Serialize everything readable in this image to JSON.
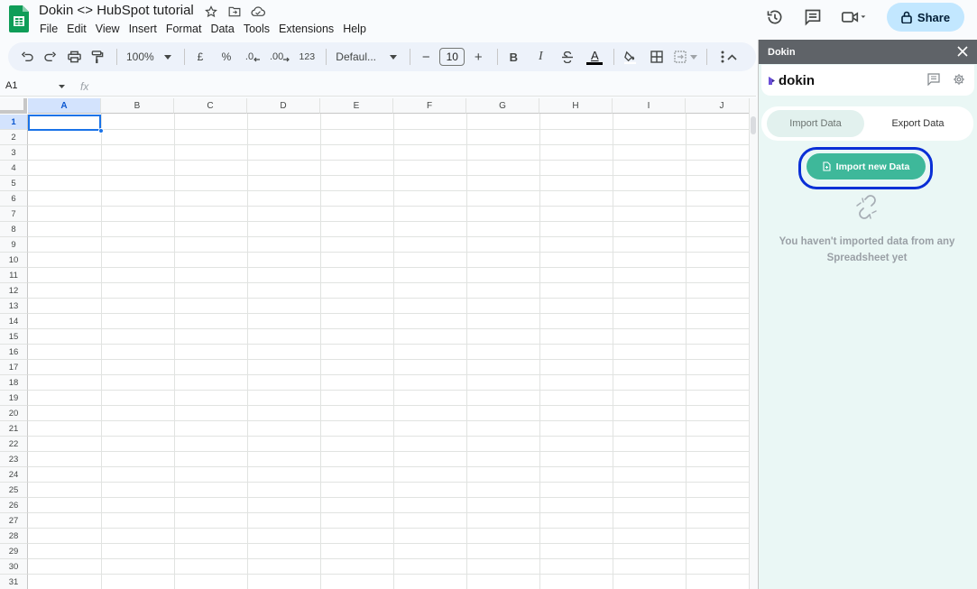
{
  "document": {
    "title": "Dokin <> HubSpot tutorial"
  },
  "menu": [
    "File",
    "Edit",
    "View",
    "Insert",
    "Format",
    "Data",
    "Tools",
    "Extensions",
    "Help"
  ],
  "header": {
    "share_label": "Share"
  },
  "toolbar": {
    "zoom": "100%",
    "currency": "£",
    "percent": "%",
    "decrease_decimal": ".0",
    "increase_decimal": ".00",
    "number_format": "123",
    "font": "Defaul...",
    "font_size": "10",
    "bold": "B",
    "italic": "I",
    "text_color_glyph": "A",
    "minus": "−",
    "plus": "+"
  },
  "formula_bar": {
    "cell_ref": "A1",
    "fx": "fx"
  },
  "grid": {
    "columns": [
      "A",
      "B",
      "C",
      "D",
      "E",
      "F",
      "G",
      "H",
      "I",
      "J"
    ],
    "rows": [
      "1",
      "2",
      "3",
      "4",
      "5",
      "6",
      "7",
      "8",
      "9",
      "10",
      "11",
      "12",
      "13",
      "14",
      "15",
      "16",
      "17",
      "18",
      "19",
      "20",
      "21",
      "22",
      "23",
      "24",
      "25",
      "26",
      "27",
      "28",
      "29",
      "30",
      "31"
    ],
    "selected_cell": "A1"
  },
  "panel": {
    "title": "Dokin",
    "brand": "dokin",
    "tabs": {
      "import": "Import Data",
      "export": "Export Data"
    },
    "import_button": "Import new Data",
    "empty_message": "You haven't imported data from any Spreadsheet yet",
    "accent": "#3eb89a",
    "highlight": "#0a2fd6"
  }
}
